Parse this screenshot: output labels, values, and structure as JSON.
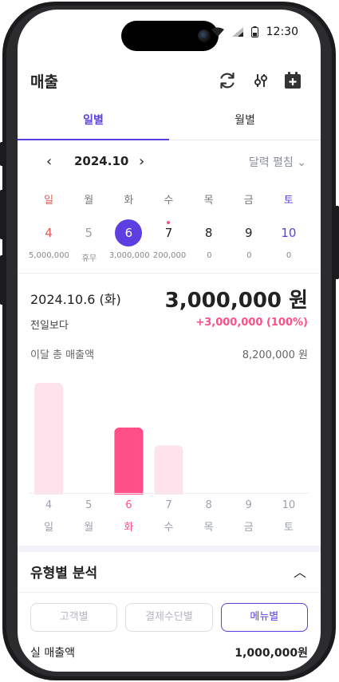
{
  "status": {
    "time": "12:30"
  },
  "header": {
    "title": "매출"
  },
  "tabs": [
    {
      "label": "일별",
      "active": true
    },
    {
      "label": "월별",
      "active": false
    }
  ],
  "calendar": {
    "month": "2024.10",
    "expand_label": "달력 펼침",
    "weekdays": [
      "일",
      "월",
      "화",
      "수",
      "목",
      "금",
      "토"
    ],
    "days": [
      {
        "date": "4",
        "amount": "5,000,000",
        "color": "#e05a5a"
      },
      {
        "date": "5",
        "amount": "휴무",
        "color": "#9aa0ad"
      },
      {
        "date": "6",
        "amount": "3,000,000",
        "selected": true
      },
      {
        "date": "7",
        "amount": "200,000",
        "dot": true
      },
      {
        "date": "8",
        "amount": "0"
      },
      {
        "date": "9",
        "amount": "0"
      },
      {
        "date": "10",
        "amount": "0",
        "color": "#5b3fe0"
      }
    ]
  },
  "summary": {
    "date": "2024.10.6 (화)",
    "value": "3,000,000 원",
    "prev_label": "전일보다",
    "prev_change": "+3,000,000 (100%)",
    "total_label": "이달 총 매출액",
    "total_value": "8,200,000 원"
  },
  "chart_data": {
    "type": "bar",
    "categories": [
      "4",
      "5",
      "6",
      "7",
      "8",
      "9",
      "10"
    ],
    "weekdays": [
      "일",
      "월",
      "화",
      "수",
      "목",
      "금",
      "토"
    ],
    "values": [
      5000000,
      0,
      3000000,
      2200000,
      0,
      0,
      0
    ],
    "highlight_index": 2,
    "colors": {
      "normal": "#ffe3ec",
      "highlight": "#ff4f86"
    },
    "ylim": [
      0,
      5000000
    ]
  },
  "analysis": {
    "title": "유형별 분석",
    "filters": [
      {
        "label": "고객별",
        "active": false
      },
      {
        "label": "결제수단별",
        "active": false
      },
      {
        "label": "메뉴별",
        "active": true
      }
    ],
    "net_label": "실 매출액",
    "net_value": "1,000,000원"
  },
  "colors": {
    "accent": "#5b3fe0",
    "pink": "#ff4f86"
  }
}
